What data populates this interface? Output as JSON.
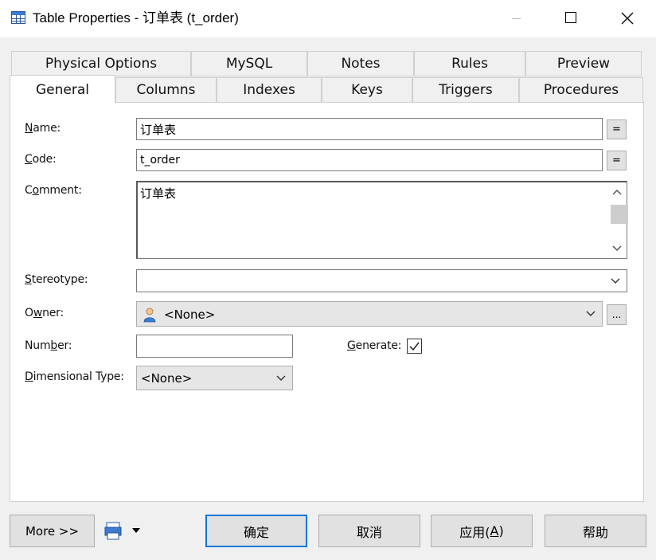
{
  "window": {
    "title": "Table Properties - 订单表 (t_order)"
  },
  "tabs_back": [
    {
      "label": "Physical Options"
    },
    {
      "label": "MySQL"
    },
    {
      "label": "Notes"
    },
    {
      "label": "Rules"
    },
    {
      "label": "Preview"
    }
  ],
  "tabs_front": [
    {
      "label": "General"
    },
    {
      "label": "Columns"
    },
    {
      "label": "Indexes"
    },
    {
      "label": "Keys"
    },
    {
      "label": "Triggers"
    },
    {
      "label": "Procedures"
    }
  ],
  "active_tab": "General",
  "form": {
    "name": {
      "mnemonic": "N",
      "label_rest": "ame:",
      "value": "订单表",
      "eq": "="
    },
    "code": {
      "mnemonic": "C",
      "label_rest": "ode:",
      "value": "t_order",
      "eq": "="
    },
    "comment": {
      "pre": "C",
      "mnemonic": "o",
      "label_rest": "mment:",
      "value": "订单表"
    },
    "stereotype": {
      "mnemonic": "S",
      "label_rest": "tereotype:",
      "value": ""
    },
    "owner": {
      "pre": "O",
      "mnemonic": "w",
      "label_rest": "ner:",
      "value": "<None>",
      "ellipsis": "..."
    },
    "number": {
      "pre": "Num",
      "mnemonic": "b",
      "label_rest": "er:",
      "value": ""
    },
    "generate": {
      "mnemonic": "G",
      "label_rest": "enerate:",
      "checked": true
    },
    "dimensional_type": {
      "mnemonic": "D",
      "label_rest": "imensional Type:",
      "value": "<None>"
    }
  },
  "footer": {
    "more": "More >>",
    "ok": "确定",
    "cancel": "取消",
    "apply_pre": "应用(",
    "apply_mnemonic": "A",
    "apply_post": ")",
    "help": "帮助"
  }
}
